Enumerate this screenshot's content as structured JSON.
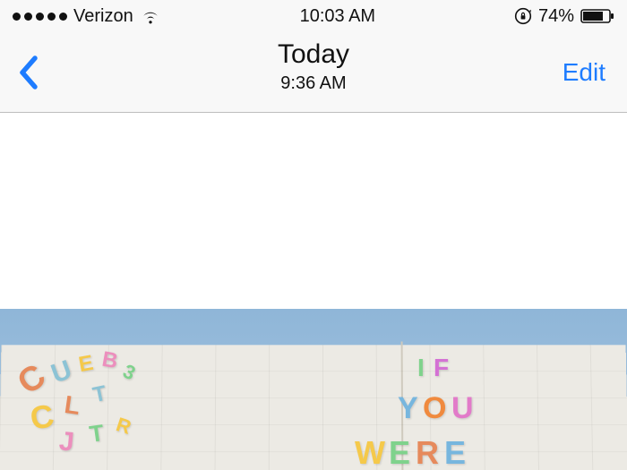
{
  "status_bar": {
    "carrier": "Verizon",
    "time": "10:03 AM",
    "battery_pct": "74%",
    "battery_level": 0.74
  },
  "nav": {
    "title": "Today",
    "subtitle": "9:36 AM",
    "edit_label": "Edit"
  },
  "photo": {
    "mural_words": {
      "right": [
        "IF",
        "YOU",
        "WERE"
      ]
    }
  }
}
